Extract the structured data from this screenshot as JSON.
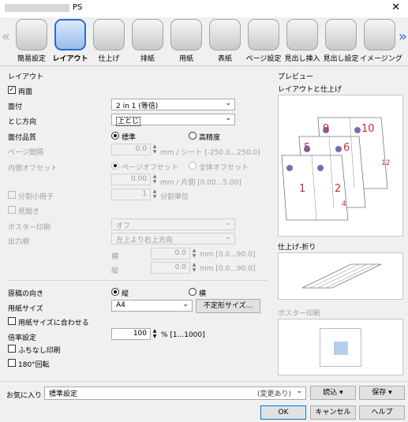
{
  "window": {
    "title": "PS",
    "close_label": "✕"
  },
  "tabs": [
    {
      "label": "簡易設定"
    },
    {
      "label": "レイアウト"
    },
    {
      "label": "仕上げ"
    },
    {
      "label": "排紙"
    },
    {
      "label": "用紙"
    },
    {
      "label": "表紙"
    },
    {
      "label": "ページ設定"
    },
    {
      "label": "見出し挿入"
    },
    {
      "label": "見出し設定"
    },
    {
      "label": "イメージング"
    }
  ],
  "layout": {
    "section": "レイアウト",
    "duplex_label": "両面",
    "pages_per_sheet": {
      "label": "面付",
      "value": "2 in 1 (等倍)"
    },
    "binding": {
      "label": "とじ方向",
      "value": "上とじ"
    },
    "imposition_quality": {
      "label": "面付品質",
      "standard": "標準",
      "high": "高精度"
    },
    "page_gap": {
      "label": "ページ間隔",
      "value": "0.0",
      "unit": "mm / シート [-250.0...250.0]"
    },
    "inner_offset": {
      "label": "内側オフセット",
      "page_offset": "ページオフセット",
      "all_offset": "全体オフセット",
      "value": "0.00",
      "unit": "mm / 片側 [0.00...5.00]"
    },
    "booklet": {
      "label": "分割小冊子",
      "value": "1",
      "unit": "分割単位"
    },
    "spread_label": "見開き",
    "poster": {
      "label": "ポスター印刷",
      "value": "オフ"
    },
    "output_order": {
      "label": "出力順",
      "value": "左上より右上方向"
    },
    "horizontal": {
      "label": "横",
      "value": "0.0",
      "unit": "mm [0.0...90.0]"
    },
    "vertical": {
      "label": "縦",
      "value": "0.0",
      "unit": "mm [0.0...90.0]"
    },
    "orientation": {
      "label": "原稿の向き",
      "portrait": "縦",
      "landscape": "横"
    },
    "paper_size": {
      "label": "用紙サイズ",
      "value": "A4",
      "custom_button": "不定形サイズ..."
    },
    "fit_to_paper": "用紙サイズに合わせる",
    "zoom": {
      "label": "倍率設定",
      "value": "100",
      "unit": "% [1...1000]"
    },
    "borderless": "ふちなし印刷",
    "rotate180": "180°回転"
  },
  "preview": {
    "section": "プレビュー",
    "layout_finish": "レイアウトと仕上げ",
    "finish_fold": "仕上げ-折り",
    "poster_print": "ポスター印刷",
    "page_numbers": [
      "1",
      "2",
      "4",
      "5",
      "6",
      "9",
      "10",
      "12"
    ]
  },
  "footer": {
    "favorites_label": "お気に入り",
    "favorites_value": "標準設定",
    "changed_note": "(変更あり)",
    "load_button": "読込",
    "save_button": "保存",
    "ok_button": "OK",
    "cancel_button": "キャンセル",
    "help_button": "ヘルプ"
  }
}
